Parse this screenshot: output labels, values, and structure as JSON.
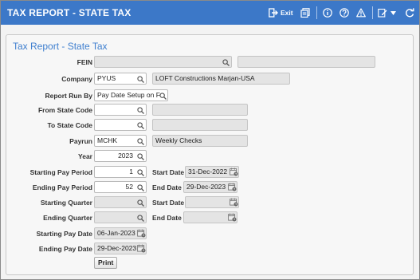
{
  "header": {
    "title": "TAX REPORT - STATE TAX",
    "exit_label": "Exit",
    "accent": "#3c78c8"
  },
  "form": {
    "title": "Tax Report - State Tax",
    "fein": {
      "label": "FEIN",
      "value": "",
      "description": ""
    },
    "company": {
      "label": "Company",
      "value": "PYUS",
      "description": "LOFT Constructions Marjan-USA"
    },
    "report_run_by": {
      "label": "Report Run By",
      "value": "Pay Date Setup on F"
    },
    "from_state": {
      "label": "From State Code",
      "value": "",
      "description": ""
    },
    "to_state": {
      "label": "To State Code",
      "value": "",
      "description": ""
    },
    "payrun": {
      "label": "Payrun",
      "value": "MCHK",
      "description": "Weekly Checks"
    },
    "year": {
      "label": "Year",
      "value": "2023"
    },
    "starting_pay_period": {
      "label": "Starting Pay Period",
      "value": "1",
      "date_label": "Start Date",
      "date": "31-Dec-2022"
    },
    "ending_pay_period": {
      "label": "Ending Pay Period",
      "value": "52",
      "date_label": "End Date",
      "date": "29-Dec-2023"
    },
    "starting_quarter": {
      "label": "Starting Quarter",
      "value": "",
      "date_label": "Start Date",
      "date": ""
    },
    "ending_quarter": {
      "label": "Ending Quarter",
      "value": "",
      "date_label": "End Date",
      "date": ""
    },
    "starting_pay_date": {
      "label": "Starting Pay Date",
      "value": "06-Jan-2023"
    },
    "ending_pay_date": {
      "label": "Ending Pay Date",
      "value": "29-Dec-2023"
    },
    "print_label": "Print"
  }
}
